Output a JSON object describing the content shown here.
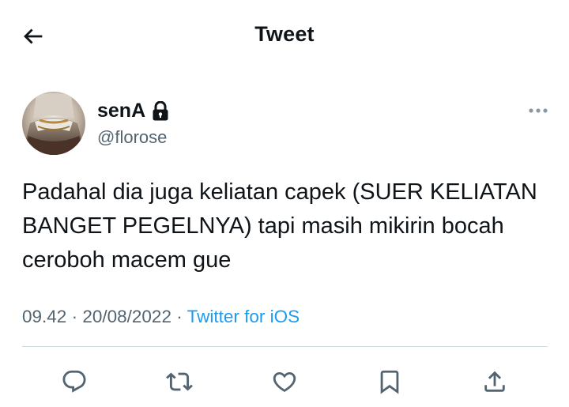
{
  "header": {
    "title": "Tweet",
    "back_icon": "arrow-left-icon"
  },
  "author": {
    "display_name": "senA",
    "handle": "@florose",
    "protected_icon": "lock-icon",
    "more_icon": "more-horizontal-icon"
  },
  "tweet": {
    "text": "Padahal dia juga keliatan capek (SUER KELIATAN BANGET PEGELNYA) tapi masih mikirin bocah ceroboh macem gue",
    "time": "09.42",
    "separator": "·",
    "date": "20/08/2022",
    "source": "Twitter for iOS"
  },
  "actions": [
    {
      "icon": "reply-icon"
    },
    {
      "icon": "retweet-icon"
    },
    {
      "icon": "like-icon"
    },
    {
      "icon": "bookmark-icon"
    },
    {
      "icon": "share-icon"
    }
  ],
  "colors": {
    "text": "#0f1419",
    "secondary": "#536471",
    "accent": "#1d9bf0",
    "divider": "#cfd9de"
  }
}
